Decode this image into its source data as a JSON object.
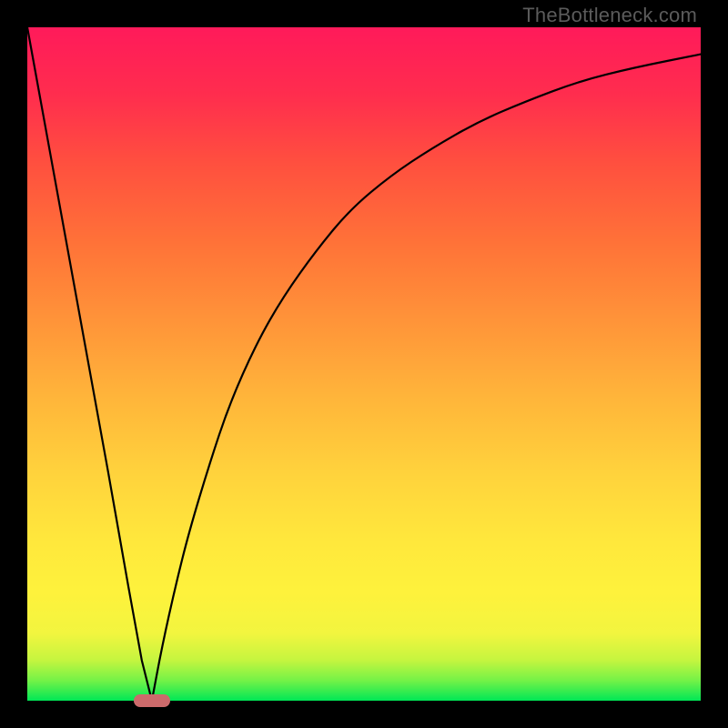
{
  "watermark": "TheBottleneck.com",
  "chart_data": {
    "type": "line",
    "title": "",
    "xlabel": "",
    "ylabel": "",
    "xlim": [
      0,
      100
    ],
    "ylim": [
      0,
      100
    ],
    "grid": false,
    "series": [
      {
        "name": "left-branch",
        "x": [
          0,
          4,
          8,
          12,
          15,
          17,
          18.5
        ],
        "values": [
          100,
          78,
          56,
          34,
          17,
          6,
          0
        ]
      },
      {
        "name": "right-branch",
        "x": [
          18.5,
          20,
          22,
          24,
          27,
          30,
          34,
          38,
          43,
          48,
          54,
          60,
          67,
          74,
          82,
          90,
          100
        ],
        "values": [
          0,
          8,
          17,
          25,
          35,
          44,
          53,
          60,
          67,
          73,
          78,
          82,
          86,
          89,
          92,
          94,
          96
        ]
      }
    ],
    "annotations": [
      {
        "name": "minimum-marker",
        "x": 18.5,
        "y": 0,
        "color": "#cc6a6b"
      }
    ],
    "background_gradient": {
      "type": "vertical",
      "stops": [
        {
          "pos": 0.0,
          "color": "#00e756"
        },
        {
          "pos": 0.1,
          "color": "#f2f53f"
        },
        {
          "pos": 0.45,
          "color": "#ffb53a"
        },
        {
          "pos": 0.8,
          "color": "#ff4f3f"
        },
        {
          "pos": 1.0,
          "color": "#ff1a5a"
        }
      ]
    }
  }
}
